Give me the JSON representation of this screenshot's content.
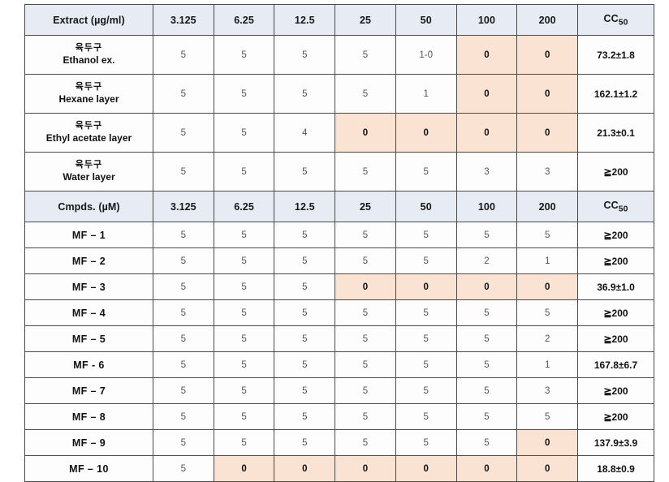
{
  "table": {
    "columns": {
      "dose_headers": [
        "3.125",
        "6.25",
        "12.5",
        "25",
        "50",
        "100",
        "200"
      ],
      "cc50_header": "CC50",
      "cc50_base": "CC",
      "cc50_sub": "50"
    },
    "section_headers": {
      "extract_label": "Extract (µg/ml)",
      "cmpds_label": "Cmpds. (µM)"
    },
    "extract_rows": [
      {
        "ko": "육두구",
        "en": "Ethanol ex.",
        "values": [
          "5",
          "5",
          "5",
          "5",
          "1-0",
          "0",
          "0"
        ],
        "highlight": [
          false,
          false,
          false,
          false,
          false,
          true,
          true
        ],
        "cc50": "73.2±1.8"
      },
      {
        "ko": "육두구",
        "en": "Hexane layer",
        "values": [
          "5",
          "5",
          "5",
          "5",
          "1",
          "0",
          "0"
        ],
        "highlight": [
          false,
          false,
          false,
          false,
          false,
          true,
          true
        ],
        "cc50": "162.1±1.2"
      },
      {
        "ko": "육두구",
        "en": "Ethyl acetate layer",
        "values": [
          "5",
          "5",
          "4",
          "0",
          "0",
          "0",
          "0"
        ],
        "highlight": [
          false,
          false,
          false,
          true,
          true,
          true,
          true
        ],
        "cc50": "21.3±0.1"
      },
      {
        "ko": "육두구",
        "en": "Water layer",
        "values": [
          "5",
          "5",
          "5",
          "5",
          "5",
          "3",
          "3"
        ],
        "highlight": [
          false,
          false,
          false,
          false,
          false,
          false,
          false
        ],
        "cc50": "≧200"
      }
    ],
    "compound_rows": [
      {
        "label": "MF – 1",
        "values": [
          "5",
          "5",
          "5",
          "5",
          "5",
          "5",
          "5"
        ],
        "highlight": [
          false,
          false,
          false,
          false,
          false,
          false,
          false
        ],
        "cc50": "≧200"
      },
      {
        "label": "MF – 2",
        "values": [
          "5",
          "5",
          "5",
          "5",
          "5",
          "2",
          "1"
        ],
        "highlight": [
          false,
          false,
          false,
          false,
          false,
          false,
          false
        ],
        "cc50": "≧200"
      },
      {
        "label": "MF – 3",
        "values": [
          "5",
          "5",
          "5",
          "0",
          "0",
          "0",
          "0"
        ],
        "highlight": [
          false,
          false,
          false,
          true,
          true,
          true,
          true
        ],
        "cc50": "36.9±1.0"
      },
      {
        "label": "MF – 4",
        "values": [
          "5",
          "5",
          "5",
          "5",
          "5",
          "5",
          "5"
        ],
        "highlight": [
          false,
          false,
          false,
          false,
          false,
          false,
          false
        ],
        "cc50": "≧200"
      },
      {
        "label": "MF – 5",
        "values": [
          "5",
          "5",
          "5",
          "5",
          "5",
          "5",
          "2"
        ],
        "highlight": [
          false,
          false,
          false,
          false,
          false,
          false,
          false
        ],
        "cc50": "≧200"
      },
      {
        "label": "MF - 6",
        "values": [
          "5",
          "5",
          "5",
          "5",
          "5",
          "5",
          "1"
        ],
        "highlight": [
          false,
          false,
          false,
          false,
          false,
          false,
          false
        ],
        "cc50": "167.8±6.7"
      },
      {
        "label": "MF – 7",
        "values": [
          "5",
          "5",
          "5",
          "5",
          "5",
          "5",
          "3"
        ],
        "highlight": [
          false,
          false,
          false,
          false,
          false,
          false,
          false
        ],
        "cc50": "≧200"
      },
      {
        "label": "MF – 8",
        "values": [
          "5",
          "5",
          "5",
          "5",
          "5",
          "5",
          "5"
        ],
        "highlight": [
          false,
          false,
          false,
          false,
          false,
          false,
          false
        ],
        "cc50": "≧200"
      },
      {
        "label": "MF – 9",
        "values": [
          "5",
          "5",
          "5",
          "5",
          "5",
          "5",
          "0"
        ],
        "highlight": [
          false,
          false,
          false,
          false,
          false,
          false,
          true
        ],
        "cc50": "137.9±3.9"
      },
      {
        "label": "MF – 10",
        "values": [
          "5",
          "0",
          "0",
          "0",
          "0",
          "0",
          "0"
        ],
        "highlight": [
          false,
          true,
          true,
          true,
          true,
          true,
          true
        ],
        "cc50": "18.8±0.9"
      }
    ]
  },
  "colors": {
    "header_background": "#e6ebf4",
    "highlight_background": "#fae3d2",
    "border": "#4a4a4a",
    "text": "#111111",
    "value_text": "#555555"
  }
}
